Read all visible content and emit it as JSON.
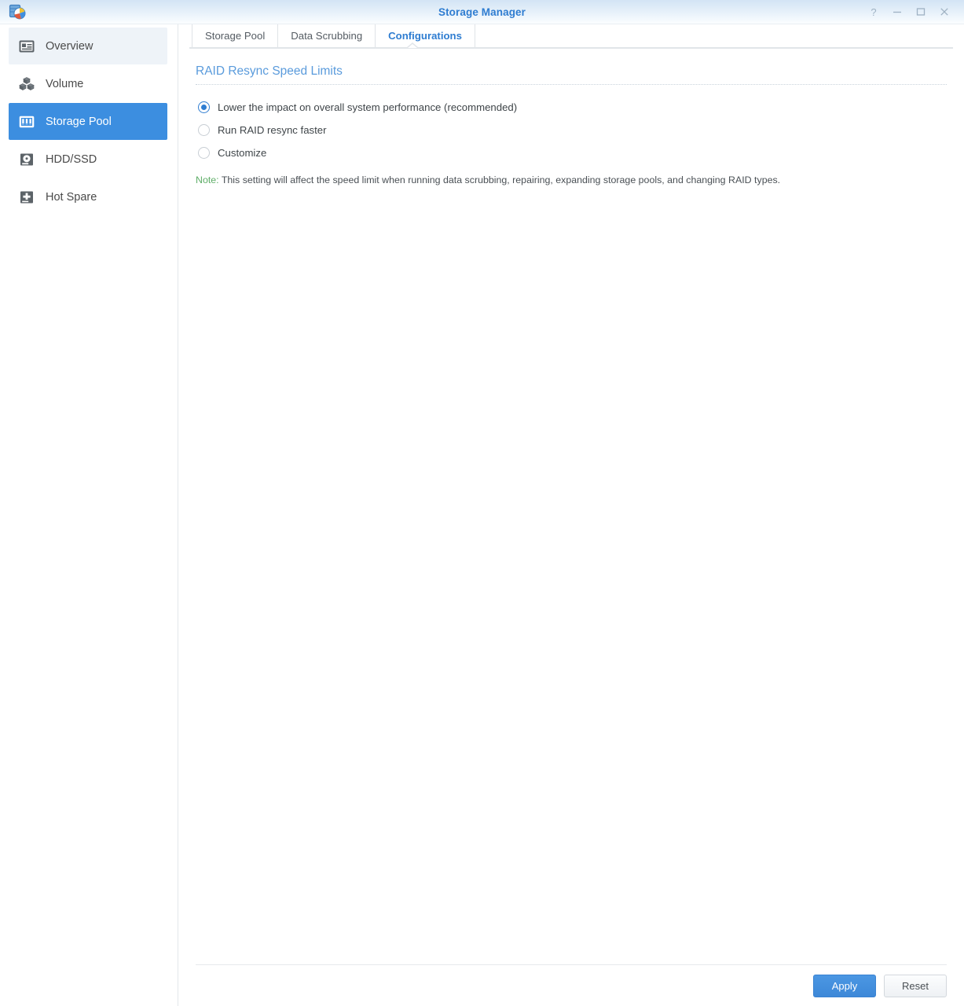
{
  "window": {
    "title": "Storage Manager",
    "app_icon": "storage-manager-icon",
    "controls": [
      {
        "name": "help-icon",
        "glyph": "?"
      },
      {
        "name": "minimize-icon",
        "glyph": "−"
      },
      {
        "name": "maximize-icon",
        "glyph": "□"
      },
      {
        "name": "close-icon",
        "glyph": "✕"
      }
    ],
    "title_color": "#2f7dd1"
  },
  "sidebar": {
    "items": [
      {
        "label": "Overview",
        "icon": "overview-card-icon",
        "state": "hover"
      },
      {
        "label": "Volume",
        "icon": "cubes-icon",
        "state": "normal"
      },
      {
        "label": "Storage Pool",
        "icon": "drive-bays-icon",
        "state": "active"
      },
      {
        "label": "HDD/SSD",
        "icon": "hard-disk-icon",
        "state": "normal"
      },
      {
        "label": "Hot Spare",
        "icon": "plus-drive-icon",
        "state": "normal"
      }
    ],
    "active_color": "#3c8ee0"
  },
  "tabs": [
    {
      "label": "Storage Pool",
      "active": false
    },
    {
      "label": "Data Scrubbing",
      "active": false
    },
    {
      "label": "Configurations",
      "active": true
    }
  ],
  "panel": {
    "section_title": "RAID Resync Speed Limits",
    "section_title_color": "#5a9bdc",
    "options": [
      {
        "label": "Lower the impact on overall system performance (recommended)",
        "selected": true
      },
      {
        "label": "Run RAID resync faster",
        "selected": false
      },
      {
        "label": "Customize",
        "selected": false
      }
    ],
    "note_keyword": "Note:",
    "note_keyword_color": "#5fae68",
    "note_text": "This setting will affect the speed limit when running data scrubbing, repairing, expanding storage pools, and changing RAID types."
  },
  "footer": {
    "apply_label": "Apply",
    "reset_label": "Reset",
    "apply_color": "#3d88d8"
  }
}
